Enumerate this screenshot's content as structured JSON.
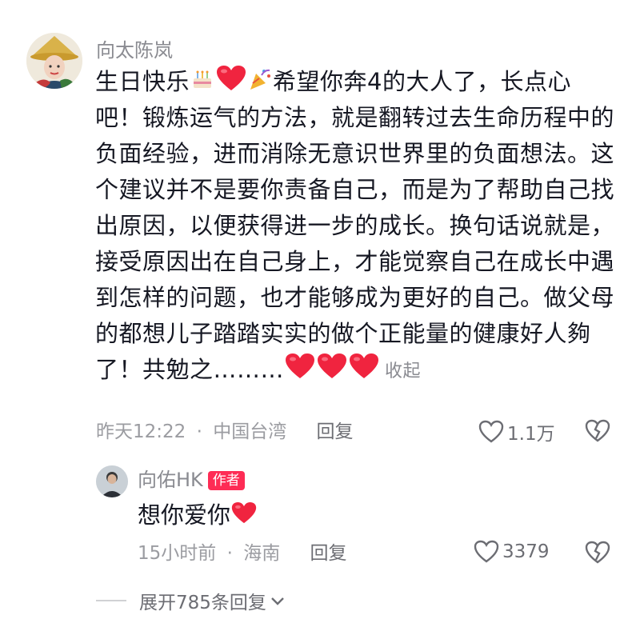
{
  "comment": {
    "author": "向太陈岚",
    "avatar_icon": "avatar-woman-gold-hat",
    "lines": [
      {
        "text": "生日快乐",
        "after_emojis": [
          "cake-emoji",
          "heart-emoji",
          "party-popper-emoji"
        ],
        "tail": "希望你奔4的大人了，长点心"
      },
      {
        "text": "吧！锻炼运气的方法，就是翻转过去生命历程中的"
      },
      {
        "text": "负面经验，进而消除无意识世界里的负面想法。这"
      },
      {
        "text": "个建议并不是要你责备自己，而是为了帮助自己找"
      },
      {
        "text": "出原因，以便获得进一步的成长。换句话说就是，"
      },
      {
        "text": "接受原因出在自己身上，才能觉察自己在成长中遇"
      },
      {
        "text": "到怎样的问题，也才能够成为更好的自己。做父母"
      },
      {
        "text": "的都想儿子踏踏实实的做个正能量的健康好人夠"
      },
      {
        "text": "了！共勉之………",
        "after_emojis": [
          "heart-emoji",
          "heart-emoji",
          "heart-emoji"
        ]
      }
    ],
    "collapse_label": "收起",
    "time": "昨天12:22",
    "separator": "·",
    "location": "中国台湾",
    "reply_label": "回复",
    "like_count": "1.1万"
  },
  "reply": {
    "author": "向佑HK",
    "author_badge": "作者",
    "avatar_icon": "avatar-man",
    "text": "想你爱你",
    "text_emoji": "heart-emoji",
    "time": "15小时前",
    "separator": "·",
    "location": "海南",
    "reply_label": "回复",
    "like_count": "3379"
  },
  "expand_label": "展开785条回复",
  "colors": {
    "heart": "#f0243f",
    "badge": "#fe2c55",
    "gray": "#8a8b91"
  }
}
